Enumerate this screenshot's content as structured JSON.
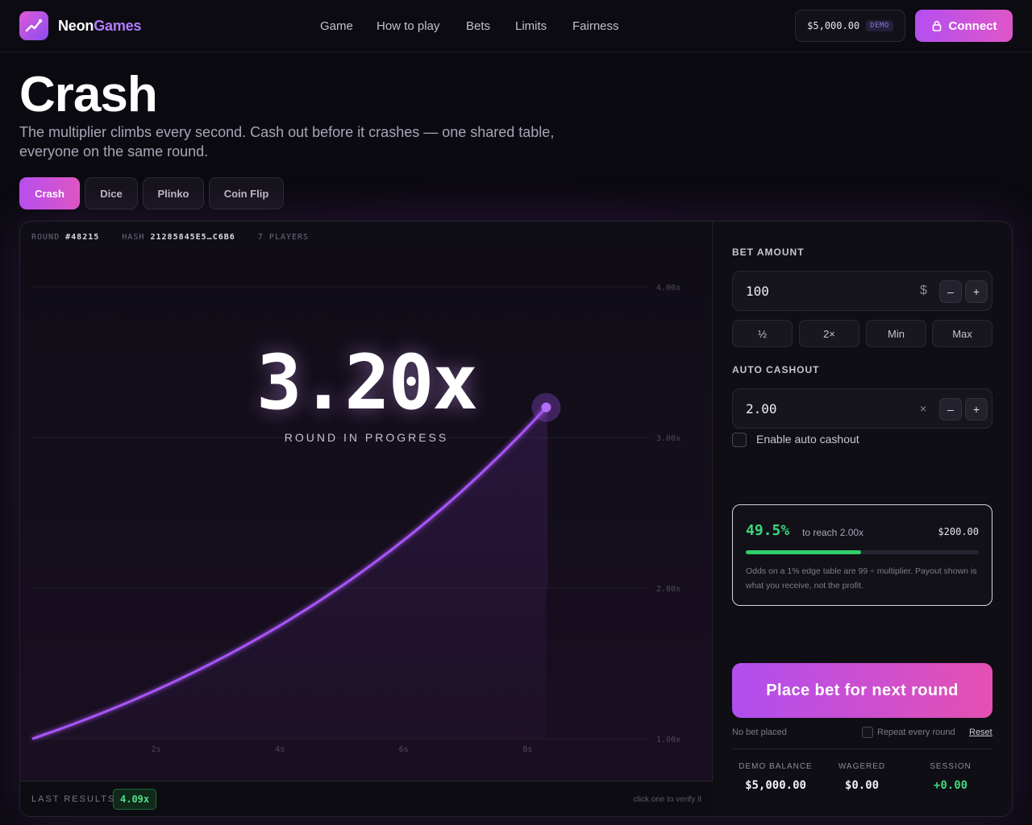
{
  "header": {
    "brand_first": "Neon",
    "brand_second": "Games",
    "nav": [
      "Game",
      "How to play",
      "Bets",
      "Limits",
      "Fairness"
    ],
    "balance": "$5,000.00",
    "balance_tag": "DEMO",
    "connect_label": "Connect"
  },
  "hero": {
    "title": "Crash",
    "subtitle": "The multiplier climbs every second. Cash out before it crashes — one shared table, everyone on the same round.",
    "tabs": [
      "Crash",
      "Dice",
      "Plinko",
      "Coin Flip"
    ],
    "active_tab": "Crash"
  },
  "round": {
    "round_label": "ROUND",
    "round_id": "#48215",
    "hash_label": "HASH",
    "hash": "21285845E5…C6B6",
    "players": "7 PLAYERS",
    "multiplier": "3.20x",
    "status": "ROUND IN PROGRESS"
  },
  "chart_data": {
    "type": "line",
    "x_ticks": [
      "2s",
      "4s",
      "6s",
      "8s"
    ],
    "y_ticks": [
      "1.00x",
      "2.00x",
      "3.00x",
      "4.00x"
    ],
    "y_values": [
      1,
      2,
      3,
      4
    ],
    "x_values": [
      2,
      4,
      6,
      8
    ],
    "current_point": {
      "t": 8.3,
      "multiplier": 3.2
    },
    "ylim": [
      1,
      4
    ],
    "line_color": "#a855f7"
  },
  "results": {
    "label": "LAST RESULTS",
    "items": [
      "4.09x"
    ],
    "hint": "click one to verify it"
  },
  "bet": {
    "amount_label": "BET AMOUNT",
    "amount": "100",
    "amount_unit": "$",
    "minus": "–",
    "plus": "+",
    "quick": [
      "½",
      "2×",
      "Min",
      "Max"
    ],
    "auto_label": "AUTO CASHOUT",
    "auto_value": "2.00",
    "auto_unit": "×",
    "enable_auto_label": "Enable auto cashout",
    "enable_auto_checked": false,
    "odds_pct": "49.5%",
    "odds_reach": "to reach 2.00x",
    "odds_payout": "$200.00",
    "odds_progress": 0.495,
    "odds_note": "Odds on a 1% edge table are 99 ÷ multiplier. Payout shown is what you receive, not the profit.",
    "place_label": "Place bet for next round",
    "status": "No bet placed",
    "repeat_label": "Repeat every round",
    "reset_label": "Reset"
  },
  "stats": [
    {
      "label": "DEMO BALANCE",
      "value": "$5,000.00"
    },
    {
      "label": "WAGERED",
      "value": "$0.00"
    },
    {
      "label": "SESSION",
      "value": "+0.00"
    }
  ],
  "colors": {
    "accent": "#b44ff0",
    "accent_pink": "#e056c8",
    "positive": "#3ed67c",
    "background": "#0b0a10"
  }
}
